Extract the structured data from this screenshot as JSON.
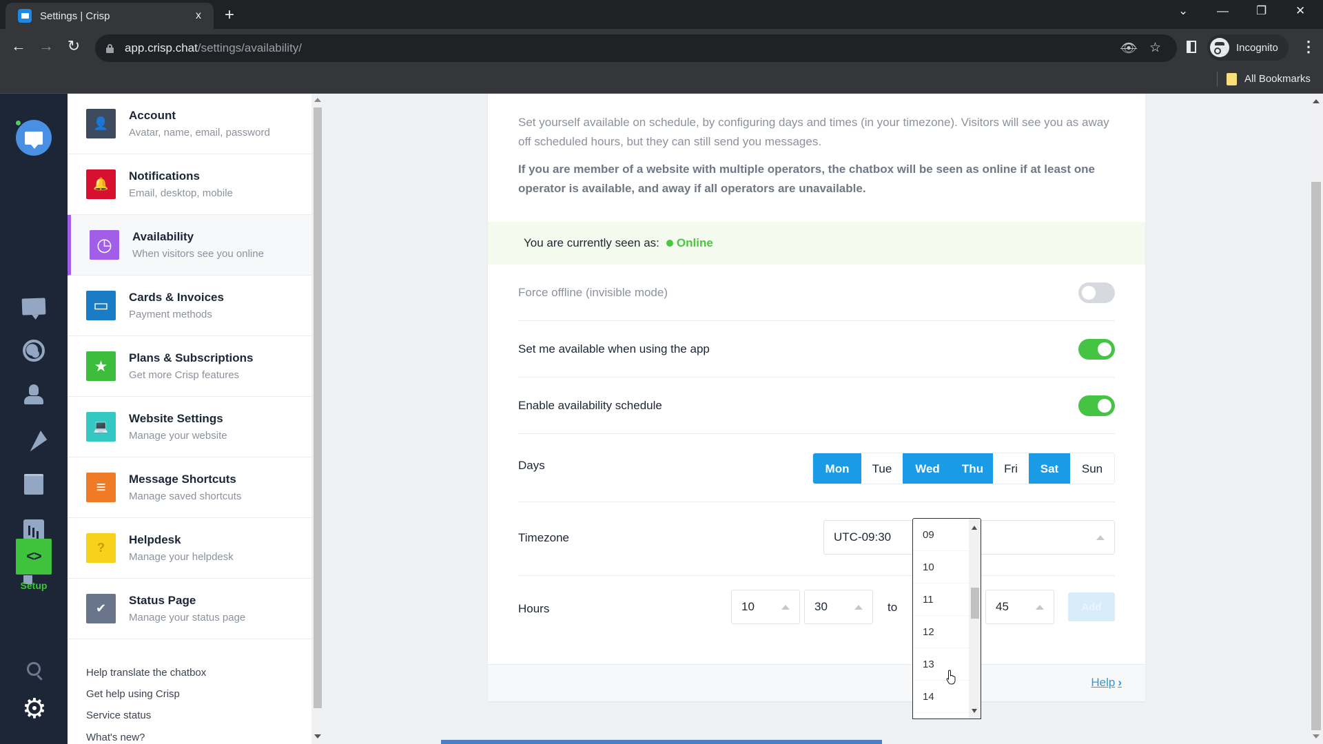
{
  "browser": {
    "tab_title": "Settings | Crisp",
    "tab_close": "x",
    "new_tab": "+",
    "url_host": "app.crisp.chat",
    "url_path": "/settings/availability/",
    "profile_label": "Incognito",
    "bookmarks_label": "All Bookmarks",
    "window_controls": {
      "dropdown": "⌄",
      "minimize": "—",
      "restore": "❐",
      "close": "✕"
    },
    "nav": {
      "back": "←",
      "forward": "→",
      "reload": "↻"
    },
    "icons": {
      "eye_off": "👁",
      "star": "☆",
      "kebab": "⋮"
    }
  },
  "rail": {
    "setup_label": "Setup",
    "setup_glyph": "<>"
  },
  "settings_nav": {
    "items": [
      {
        "title": "Account",
        "subtitle": "Avatar, name, email, password",
        "color": "#3e4a5e",
        "glyph": "👤"
      },
      {
        "title": "Notifications",
        "subtitle": "Email, desktop, mobile",
        "color": "#d8102f",
        "glyph": "🔔"
      },
      {
        "title": "Availability",
        "subtitle": "When visitors see you online",
        "color": "#a35ee8",
        "glyph": "◷",
        "active": true
      },
      {
        "title": "Cards & Invoices",
        "subtitle": "Payment methods",
        "color": "#1a7cc4",
        "glyph": "▭"
      },
      {
        "title": "Plans & Subscriptions",
        "subtitle": "Get more Crisp features",
        "color": "#3ebd3c",
        "glyph": "★"
      },
      {
        "title": "Website Settings",
        "subtitle": "Manage your website",
        "color": "#34c8c2",
        "glyph": "💻"
      },
      {
        "title": "Message Shortcuts",
        "subtitle": "Manage saved shortcuts",
        "color": "#f07b27",
        "glyph": "≡"
      },
      {
        "title": "Helpdesk",
        "subtitle": "Manage your helpdesk",
        "color": "#f7d11a",
        "glyph": "?"
      },
      {
        "title": "Status Page",
        "subtitle": "Manage your status page",
        "color": "#68758a",
        "glyph": "✔"
      }
    ],
    "links": [
      "Help translate the chatbox",
      "Get help using Crisp",
      "Service status",
      "What's new?"
    ]
  },
  "main": {
    "intro": "Set yourself available on schedule, by configuring days and times (in your timezone). Visitors will see you as away off scheduled hours, but they can still send you messages.",
    "intro_bold": "If you are member of a website with multiple operators, the chatbox will be seen as online if at least one operator is available, and away if all operators are unavailable.",
    "status_label": "You are currently seen as:",
    "status_value": "Online",
    "toggles": [
      {
        "label": "Force offline (invisible mode)",
        "on": false
      },
      {
        "label": "Set me available when using the app",
        "on": true
      },
      {
        "label": "Enable availability schedule",
        "on": true
      }
    ],
    "days_label": "Days",
    "days": [
      {
        "label": "Mon",
        "on": true
      },
      {
        "label": "Tue",
        "on": false
      },
      {
        "label": "Wed",
        "on": true
      },
      {
        "label": "Thu",
        "on": true
      },
      {
        "label": "Fri",
        "on": false
      },
      {
        "label": "Sat",
        "on": true
      },
      {
        "label": "Sun",
        "on": false
      }
    ],
    "timezone_label": "Timezone",
    "timezone_value": "UTC-09:30",
    "hours_label": "Hours",
    "hours": {
      "from_hour": "10",
      "from_minute": "30",
      "to_label": "to",
      "to_hour": "—",
      "to_minute": "45",
      "add_label": "Add"
    },
    "hour_dropdown_options": [
      "09",
      "10",
      "11",
      "12",
      "13",
      "14"
    ],
    "help_label": "Help",
    "help_chevron": "›"
  }
}
